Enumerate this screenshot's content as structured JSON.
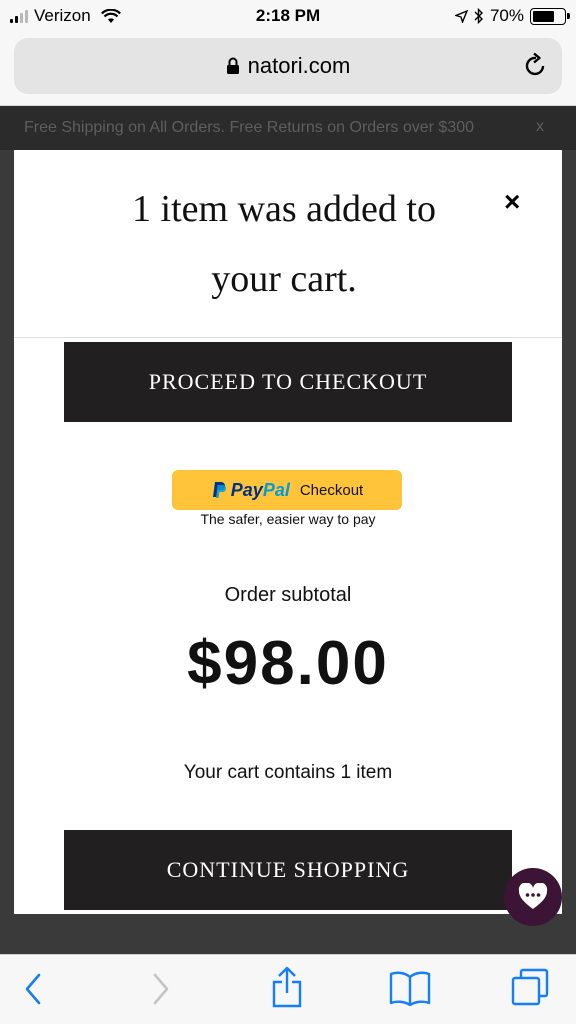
{
  "status_bar": {
    "carrier": "Verizon",
    "time": "2:18 PM",
    "battery": "70%",
    "battery_level": 0.7
  },
  "browser": {
    "url": "natori.com"
  },
  "promo": {
    "text": "Free Shipping on All Orders. Free Returns on Orders over $300",
    "close": "x"
  },
  "modal": {
    "title_line1": "1 item was added to",
    "title_line2": "your cart.",
    "close": "×",
    "checkout_label": "PROCEED TO CHECKOUT",
    "paypal_pay": "Pay",
    "paypal_pal": "Pal",
    "paypal_checkout": "Checkout",
    "paypal_tagline": "The safer, easier way to pay",
    "subtotal_label": "Order subtotal",
    "subtotal_amount": "$98.00",
    "cart_count_text": "Your cart contains 1 item",
    "continue_label": "CONTINUE SHOPPING"
  },
  "colors": {
    "button_dark": "#221f20",
    "paypal_yellow": "#ffc439",
    "paypal_dark_blue": "#003087",
    "paypal_light_blue": "#009cde",
    "chat_bubble": "#3c1536",
    "ios_blue": "#157efb"
  },
  "icons": {
    "back": "chevron-left-icon",
    "forward": "chevron-right-icon",
    "share": "share-icon",
    "bookmarks": "book-icon",
    "tabs": "tabs-icon",
    "chat": "heart-chat-icon"
  }
}
